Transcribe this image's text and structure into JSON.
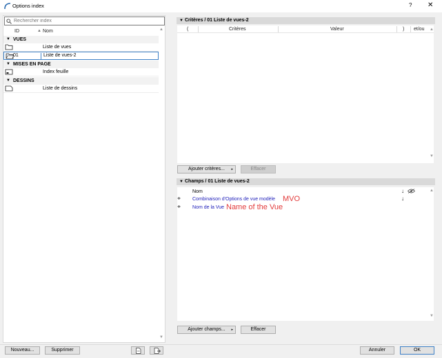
{
  "window": {
    "title": "Options index",
    "help_label": "?",
    "close_label": "✕"
  },
  "left": {
    "search_placeholder": "Rechercher index",
    "columns": {
      "id": "ID",
      "name": "Nom"
    },
    "groups": [
      {
        "label": "VUES",
        "items": [
          {
            "id": "",
            "name": "Liste de vues",
            "icon": "folder-icon"
          },
          {
            "id": "01",
            "name": "Liste de vues-2",
            "icon": "open-folder-icon"
          }
        ]
      },
      {
        "label": "MISES EN PAGE",
        "items": [
          {
            "id": "",
            "name": "Index feuille",
            "icon": "layout-sheet-icon"
          }
        ]
      },
      {
        "label": "DESSINS",
        "items": [
          {
            "id": "",
            "name": "Liste de dessins",
            "icon": "drawing-sheet-icon"
          }
        ]
      }
    ],
    "buttons": {
      "new": "Nouveau...",
      "delete": "Supprimer"
    }
  },
  "criteria": {
    "header": "Critères / 01 Liste de vues-2",
    "columns": {
      "open_paren": "(",
      "criteria": "Critères",
      "value": "Valeur",
      "close_paren": ")",
      "and_or": "et/ou"
    },
    "add_button": "Ajouter critères...",
    "clear_button": "Effacer"
  },
  "fields": {
    "header": "Champs / 01 Liste de vues-2",
    "name_col": "Nom",
    "rows": [
      {
        "name": "Combinaison d'Options de vue modèle",
        "annotation": "MVO"
      },
      {
        "name": "Nom de la Vue",
        "annotation": "Name of the Vue"
      }
    ],
    "add_button": "Ajouter champs...",
    "clear_button": "Effacer"
  },
  "footer": {
    "cancel": "Annuler",
    "ok": "OK"
  },
  "colors": {
    "selection_border": "#3c7fc6",
    "field_text": "#2222bb",
    "annotation": "#e23a3a"
  }
}
